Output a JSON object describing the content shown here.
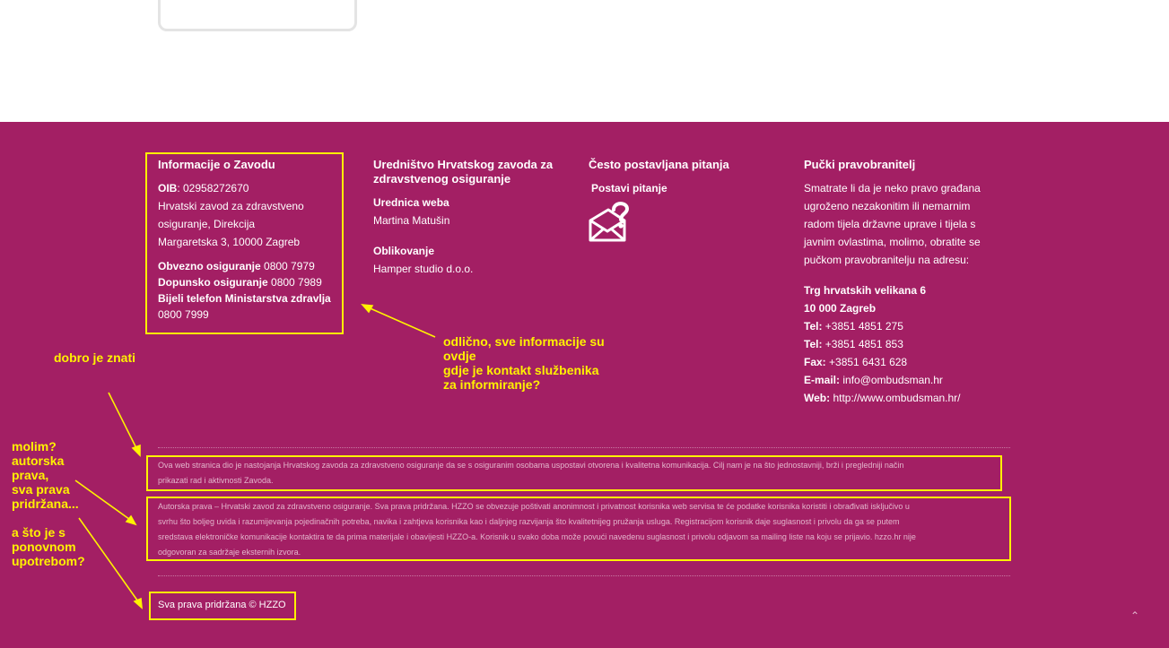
{
  "info": {
    "title": "Informacije o Zavodu",
    "oib_label": "OIB",
    "oib_value": ": 02958272670",
    "address_line1": "Hrvatski zavod za zdravstveno",
    "address_line2": "osiguranje, Direkcija",
    "address_line3": "Margaretska 3, 10000 Zagreb",
    "obvezno_label": "Obvezno osiguranje",
    "obvezno_value": " 0800 7979",
    "dopunsko_label": "Dopunsko osiguranje",
    "dopunsko_value": " 0800 7989",
    "bijeli_label": "Bijeli telefon Ministarstva zdravlja",
    "bijeli_value": "0800 7999"
  },
  "editorial": {
    "title": "Uredništvo Hrvatskog zavoda za zdravstvenog osiguranje",
    "editor_label": "Urednica weba",
    "editor_value": "Martina Matušin",
    "design_label": "Oblikovanje",
    "design_value": "Hamper studio d.o.o."
  },
  "faq": {
    "title": "Često postavljana pitanja",
    "ask_label": "Postavi pitanje"
  },
  "ombudsman": {
    "title": "Pučki pravobranitelj",
    "text1": "Smatrate li da je neko pravo građana",
    "text2": "ugroženo nezakonitim ili nemarnim",
    "text3": "radom tijela državne uprave i tijela s",
    "text4": "javnim ovlastima, molimo, obratite se",
    "text5": "pučkom pravobranitelju na adresu:",
    "street": "Trg hrvatskih velikana 6",
    "city": "10 000 Zagreb",
    "tel_label": "Tel:",
    "tel1": " +3851 4851 275",
    "tel2": " +3851 4851 853",
    "fax_label": "Fax:",
    "fax": " +3851 6431 628",
    "email_label": "E-mail:",
    "email": " info@ombudsman.hr",
    "web_label": "Web:",
    "web": " http://www.ombudsman.hr/"
  },
  "notice": {
    "mission_line1": "Ova web stranica dio je nastojanja Hrvatskog zavoda za zdravstveno osiguranje da se s osiguranim osobama uspostavi otvorena i kvalitetna komunikacija. Cilj nam je na što jednostavniji, brži i pregledniji način",
    "mission_line2": "prikazati rad i aktivnosti Zavoda.",
    "rights_line1": "Autorska prava – Hrvatski zavod za zdravstveno osiguranje. Sva prava pridržana. HZZO se obvezuje poštivati anonimnost i privatnost korisnika web servisa te će podatke korisnika koristiti i obrađivati isključivo u",
    "rights_line2": "svrhu što boljeg uvida i razumijevanja pojedinačnih potreba, navika i zahtjeva korisnika kao i daljnjeg razvijanja što kvalitetnijeg pružanja usluga. Registracijom korisnik daje suglasnost i privolu da ga se putem",
    "rights_line3": "sredstava elektroničke komunikacije kontaktira te da prima materijale i obavijesti HZZO-a. Korisnik u svako doba može povući navedenu suglasnost i privolu odjavom sa mailing liste na koju se prijavio. hzzo.hr nije",
    "rights_line4": "odgovoran za sadržaje eksternih izvora.",
    "copyright": "Sva prava pridržana © HZZO"
  },
  "annotations": {
    "a1_line1": "odlično, sve informacije su",
    "a1_line2": "ovdje",
    "a1_line3": "gdje je kontakt službenika",
    "a1_line4": "za informiranje?",
    "a2": "dobro je znati",
    "a3_line1": "molim?",
    "a3_line2": "autorska",
    "a3_line3": "prava,",
    "a3_line4": "sva prava",
    "a3_line5": "pridržana...",
    "a4_line1": "a što je s",
    "a4_line2": "ponovnom",
    "a4_line3": "upotrebom?"
  },
  "colors": {
    "footer_bg": "#a31f64",
    "highlight": "#fff200"
  },
  "icons": {
    "ask_icon": "envelope-question-icon",
    "to_top": "chevron-up-icon"
  }
}
